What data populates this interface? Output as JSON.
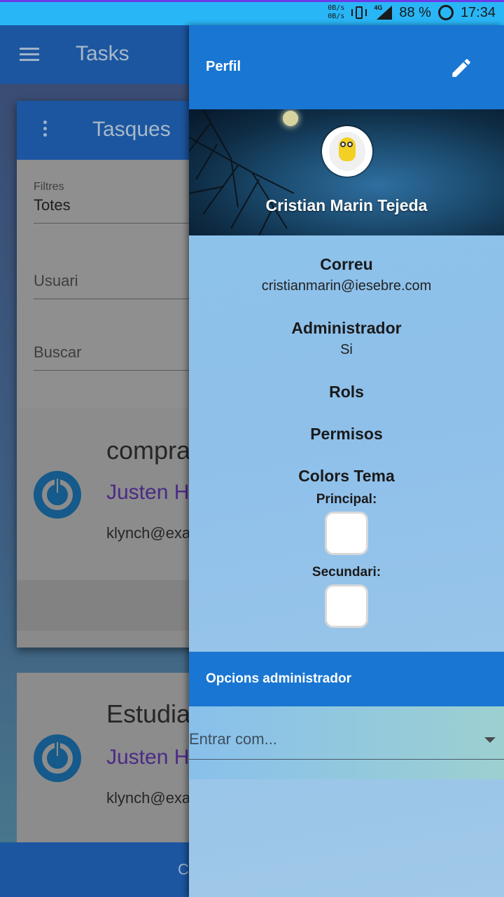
{
  "status_bar": {
    "net_up": "0B/s",
    "net_down": "0B/s",
    "network_type": "4G",
    "battery": "88 %",
    "time": "17:34"
  },
  "background_app": {
    "title": "Tasks",
    "card_title": "Tasques",
    "filters_label": "Filtres",
    "filters_value": "Totes",
    "user_placeholder": "Usuari",
    "search_placeholder": "Buscar",
    "tasks": [
      {
        "title": "compra",
        "user": "Justen H",
        "email": "klynch@exa"
      },
      {
        "title": "Estudia",
        "user": "Justen H",
        "email": "klynch@exa"
      }
    ],
    "bottom_text": "C"
  },
  "drawer": {
    "title": "Perfil",
    "user_name": "Cristian Marin Tejeda",
    "email_label": "Correu",
    "email_value": "cristianmarin@iesebre.com",
    "admin_label": "Administrador",
    "admin_value": "Si",
    "roles_label": "Rols",
    "permissions_label": "Permisos",
    "theme_label": "Colors Tema",
    "primary_label": "Principal:",
    "secondary_label": "Secundari:",
    "primary_color": "#ffffff",
    "secondary_color": "#ffffff",
    "admin_section_title": "Opcions administrador",
    "login_as_placeholder": "Entrar com..."
  },
  "colors": {
    "primary_blue": "#1976d2",
    "status_bar": "#29b6f6"
  }
}
